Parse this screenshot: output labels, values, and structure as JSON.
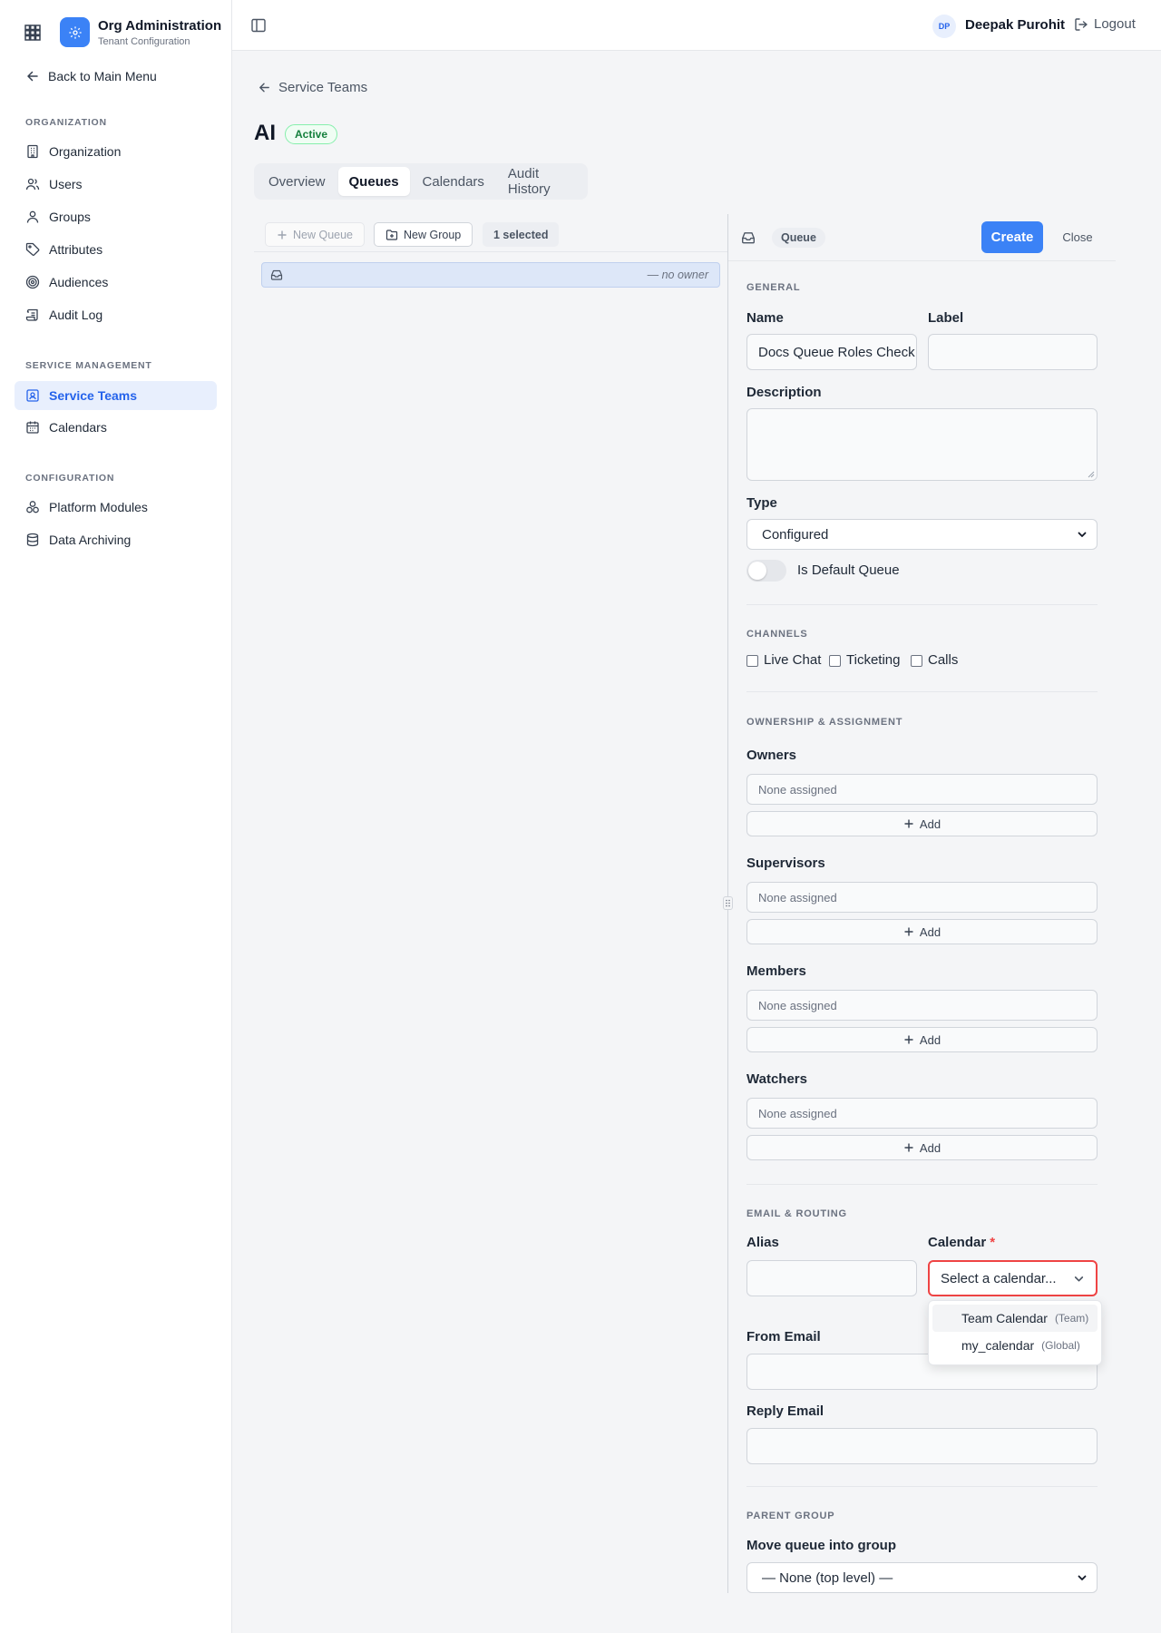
{
  "brand": {
    "title": "Org Administration",
    "subtitle": "Tenant Configuration"
  },
  "sidebar": {
    "back_label": "Back to Main Menu",
    "sections": [
      {
        "title": "ORGANIZATION",
        "items": [
          {
            "label": "Organization",
            "icon": "building-icon"
          },
          {
            "label": "Users",
            "icon": "users-icon"
          },
          {
            "label": "Groups",
            "icon": "groups-icon"
          },
          {
            "label": "Attributes",
            "icon": "tag-icon"
          },
          {
            "label": "Audiences",
            "icon": "target-icon"
          },
          {
            "label": "Audit Log",
            "icon": "scroll-icon"
          }
        ]
      },
      {
        "title": "SERVICE MANAGEMENT",
        "items": [
          {
            "label": "Service Teams",
            "icon": "contact-card-icon",
            "active": true
          },
          {
            "label": "Calendars",
            "icon": "calendar-icon"
          }
        ]
      },
      {
        "title": "CONFIGURATION",
        "items": [
          {
            "label": "Platform Modules",
            "icon": "modules-icon"
          },
          {
            "label": "Data Archiving",
            "icon": "database-icon"
          }
        ]
      }
    ]
  },
  "header": {
    "user_initials": "DP",
    "user_name": "Deepak Purohit",
    "logout_label": "Logout"
  },
  "main": {
    "breadcrumb": "Service Teams",
    "title": "AI",
    "status": "Active",
    "tabs": [
      {
        "label": "Overview"
      },
      {
        "label": "Queues",
        "active": true
      },
      {
        "label": "Calendars"
      },
      {
        "label": "Audit History"
      }
    ],
    "toolbar": {
      "new_queue": "New Queue",
      "new_group": "New Group",
      "selected": "1 selected"
    },
    "list_rows": [
      {
        "owner": "— no owner"
      }
    ]
  },
  "panel": {
    "type_pill": "Queue",
    "create_label": "Create",
    "close_label": "Close",
    "general": {
      "title": "GENERAL",
      "name_label": "Name",
      "name_value": "Docs Queue Roles Check",
      "label_label": "Label",
      "label_value": "",
      "description_label": "Description",
      "description_value": "",
      "type_label": "Type",
      "type_value": "Configured",
      "default_toggle_label": "Is Default Queue",
      "default_toggle_on": false
    },
    "channels": {
      "title": "CHANNELS",
      "options": [
        {
          "label": "Live Chat",
          "checked": false
        },
        {
          "label": "Ticketing",
          "checked": false
        },
        {
          "label": "Calls",
          "checked": false
        }
      ]
    },
    "ownership": {
      "title": "OWNERSHIP & ASSIGNMENT",
      "none_text": "None assigned",
      "add_label": "Add",
      "groups": [
        {
          "label": "Owners"
        },
        {
          "label": "Supervisors"
        },
        {
          "label": "Members"
        },
        {
          "label": "Watchers"
        }
      ]
    },
    "email": {
      "title": "EMAIL & ROUTING",
      "alias_label": "Alias",
      "alias_value": "",
      "calendar_label": "Calendar",
      "required_mark": "*",
      "calendar_placeholder": "Select a calendar...",
      "calendar_options": [
        {
          "name": "Team Calendar",
          "scope": "(Team)"
        },
        {
          "name": "my_calendar",
          "scope": "(Global)"
        }
      ],
      "from_label": "From Email",
      "from_value": "",
      "reply_label": "Reply Email",
      "reply_value": ""
    },
    "parent": {
      "title": "PARENT GROUP",
      "move_label": "Move queue into group",
      "move_value": "— None (top level) —"
    }
  },
  "colors": {
    "accent": "#3b82f6",
    "active_nav_bg": "#e8effd",
    "error": "#ef4444",
    "success": "#15803d"
  }
}
